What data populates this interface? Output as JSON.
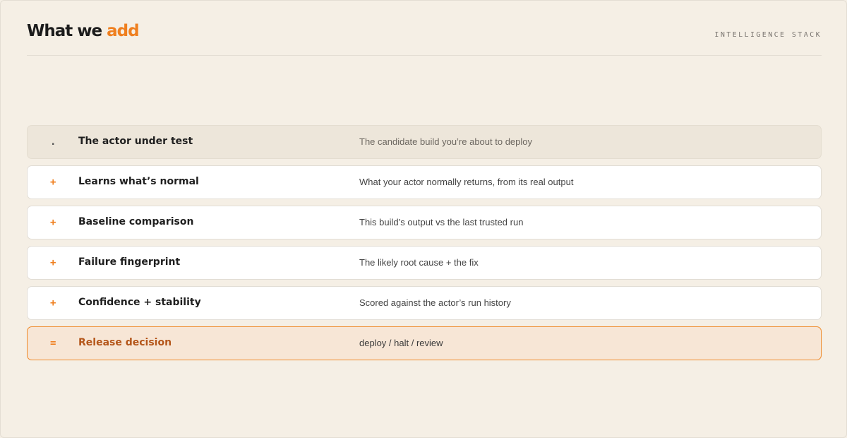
{
  "header": {
    "title_main": "What we ",
    "title_accent": "add",
    "eyebrow": "INTELLIGENCE STACK"
  },
  "rows": [
    {
      "symbol": ".",
      "label": "The actor under test",
      "description": "The candidate build you’re about to deploy"
    },
    {
      "symbol": "+",
      "label": "Learns what’s normal",
      "description": "What your actor normally returns, from its real output"
    },
    {
      "symbol": "+",
      "label": "Baseline comparison",
      "description": "This build’s output vs the last trusted run"
    },
    {
      "symbol": "+",
      "label": "Failure fingerprint",
      "description": "The likely root cause + the fix"
    },
    {
      "symbol": "+",
      "label": "Confidence + stability",
      "description": "Scored against the actor’s run history"
    },
    {
      "symbol": "=",
      "label": "Release decision",
      "description": "deploy / halt / review"
    }
  ],
  "colors": {
    "background": "#f5efe5",
    "accent": "#ef7f1f",
    "decision_border": "#ef8a2a",
    "decision_bg": "#f7e6d6"
  }
}
